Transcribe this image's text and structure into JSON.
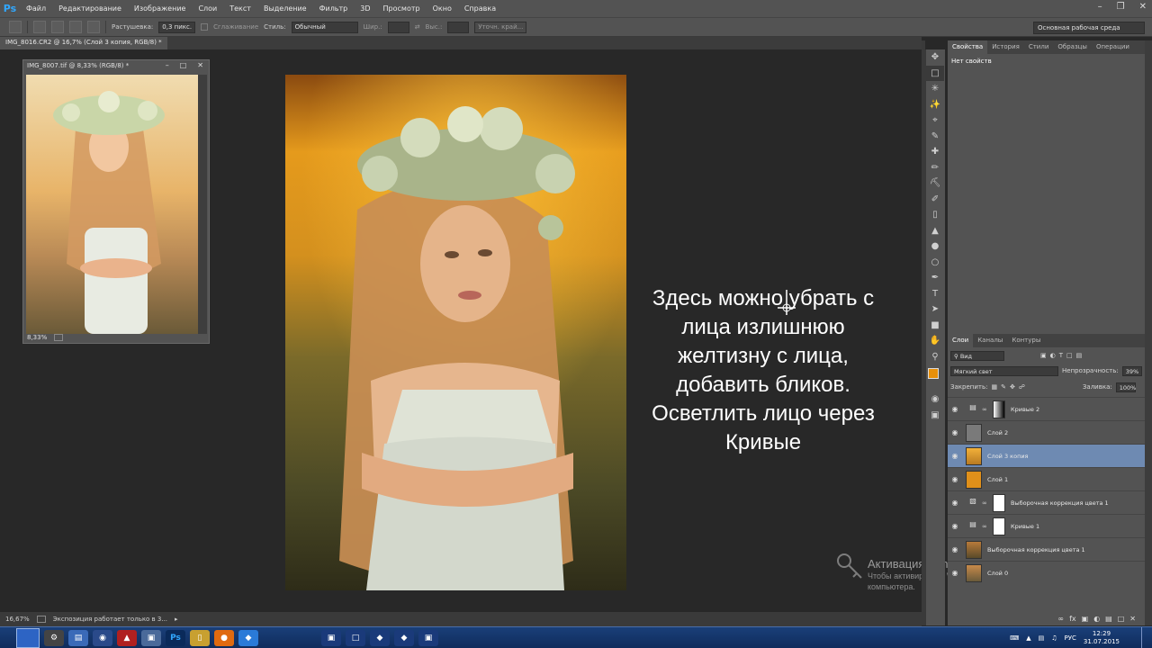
{
  "app": {
    "logo": "Ps"
  },
  "menu": [
    "Файл",
    "Редактирование",
    "Изображение",
    "Слои",
    "Текст",
    "Выделение",
    "Фильтр",
    "3D",
    "Просмотр",
    "Окно",
    "Справка"
  ],
  "options": {
    "feather_label": "Растушевка:",
    "feather_value": "0,3 пикс.",
    "smooth_label": "Сглаживание",
    "style_label": "Стиль:",
    "style_value": "Обычный",
    "width_label": "Шир.:",
    "height_label": "Выс.:",
    "refine_label": "Уточн. край...",
    "workspace": "Основная рабочая среда"
  },
  "document": {
    "tab_title": "IMG_8016.CR2 @ 16,7% (Слой 3 копия, RGB/8) *",
    "float_title": "IMG_8007.tif @ 8,33% (RGB/8) *",
    "float_zoom": "8,33%"
  },
  "annotation": {
    "lines": [
      "Здесь можно убрать с",
      "лица излишнюю",
      "желтизну с лица,",
      "добавить бликов.",
      "Осветлить лицо через",
      "Кривые"
    ]
  },
  "activation": {
    "title": "Активация Windows",
    "line1": "Чтобы активировать Windows, перейдите к параметрам",
    "line2": "компьютера."
  },
  "status": {
    "zoom": "16,67%",
    "info": "Экспозиция работает только в 3..."
  },
  "panels": {
    "top_tabs": [
      "Свойства",
      "История",
      "Стили",
      "Образцы",
      "Операции"
    ],
    "props_text": "Нет свойств",
    "layer_tabs": [
      "Слои",
      "Каналы",
      "Контуры"
    ],
    "kind_label": "Вид",
    "blend_mode": "Мягкий свет",
    "opacity_label": "Непрозрачность:",
    "opacity_value": "39%",
    "lock_label": "Закрепить:",
    "fill_label": "Заливка:",
    "fill_value": "100%"
  },
  "layers": [
    {
      "name": "Кривые 2",
      "type": "curves-mask-black"
    },
    {
      "name": "Слой 2",
      "type": "gray"
    },
    {
      "name": "Слой 3 копия",
      "type": "photo",
      "selected": true
    },
    {
      "name": "Слой 1",
      "type": "orange"
    },
    {
      "name": "Выборочная коррекция цвета 1",
      "type": "selective-mask"
    },
    {
      "name": "Кривые 1",
      "type": "curves-mask"
    },
    {
      "name": "Выборочная коррекция цвета 1",
      "type": "photo-small"
    },
    {
      "name": "Слой 0",
      "type": "photo-small"
    }
  ],
  "taskbar": {
    "lang": "РУС",
    "time": "12:29",
    "date": "31.07.2015"
  },
  "colors": {
    "accent_ps": "#31a8ff",
    "layer_selected": "#6e8ab2",
    "foreground_swatch": "#e8900a",
    "background_swatch": "#ffffff"
  }
}
